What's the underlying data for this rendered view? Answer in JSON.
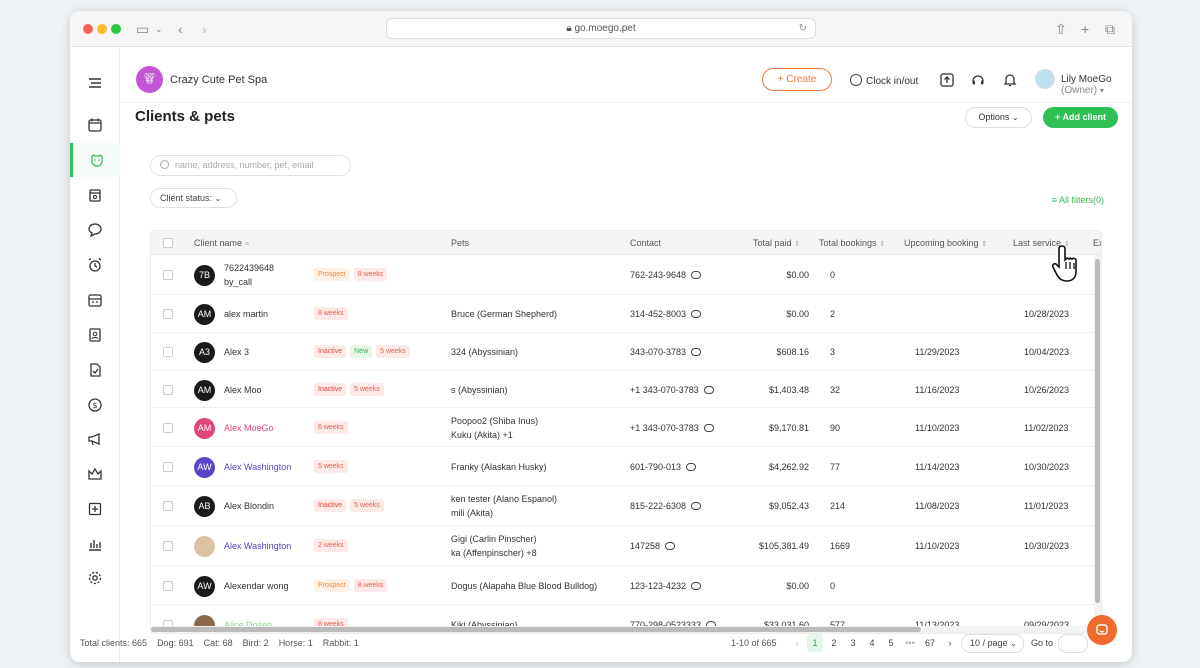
{
  "browser": {
    "url": "go.moego.pet"
  },
  "header": {
    "business_name": "Crazy Cute Pet Spa",
    "create_label": "+ Create",
    "clock_label": "Clock in/out",
    "user_name": "Lily MoeGo",
    "user_role": "(Owner)"
  },
  "sidebar": {
    "items": [
      "menu-icon",
      "calendar-icon",
      "pet-icon",
      "store-icon",
      "message-icon",
      "alarm-icon",
      "schedule-icon",
      "staff-icon",
      "card-icon",
      "dollar-icon",
      "megaphone-icon",
      "crown-icon",
      "report-icon",
      "chart-icon",
      "settings-icon"
    ],
    "active": "pet-icon"
  },
  "page": {
    "title": "Clients & pets",
    "options_label": "Options",
    "add_client_label": "+ Add client"
  },
  "filters": {
    "search_placeholder": "name, address, number, pet, email",
    "client_status_label": "Client status:",
    "all_filters_label": "All filters(0)"
  },
  "table": {
    "columns": [
      "Client name",
      "Pets",
      "Contact",
      "Total paid",
      "Total bookings",
      "Upcoming booking",
      "Last service",
      "Ex"
    ],
    "rows": [
      {
        "initials": "7B",
        "name": "7622439648",
        "subname": "by_call",
        "tags": [
          [
            "prospect",
            "Prospect"
          ],
          [
            "weeks",
            "8 weeks"
          ]
        ],
        "pets": [
          "",
          ""
        ],
        "contact": "762-243-9648",
        "paid": "$0.00",
        "bookings": "0",
        "upcoming": "",
        "last": "",
        "name_color": "#333",
        "avatar_bg": "#1a1a1a"
      },
      {
        "initials": "AM",
        "name": "alex martin",
        "subname": "",
        "tags": [
          [
            "weeks",
            "8 weeks"
          ]
        ],
        "pets": [
          "Bruce (German Shepherd)",
          ""
        ],
        "contact": "314-452-8003",
        "paid": "$0.00",
        "bookings": "2",
        "upcoming": "",
        "last": "10/28/2023",
        "name_color": "#333",
        "avatar_bg": "#1a1a1a"
      },
      {
        "initials": "A3",
        "name": "Alex 3",
        "subname": "",
        "tags": [
          [
            "inactive",
            "Inactive"
          ],
          [
            "new",
            "New"
          ],
          [
            "weeks",
            "5 weeks"
          ]
        ],
        "pets": [
          "324 (Abyssinian)",
          ""
        ],
        "contact": "343-070-3783",
        "paid": "$608.16",
        "bookings": "3",
        "upcoming": "11/29/2023",
        "last": "10/04/2023",
        "name_color": "#333",
        "avatar_bg": "#1a1a1a"
      },
      {
        "initials": "AM",
        "name": "Alex Moo",
        "subname": "",
        "tags": [
          [
            "inactive",
            "Inactive"
          ],
          [
            "weeks",
            "5 weeks"
          ]
        ],
        "pets": [
          "s (Abyssinian)",
          ""
        ],
        "contact": "+1 343-070-3783",
        "paid": "$1,403.48",
        "bookings": "32",
        "upcoming": "11/16/2023",
        "last": "10/26/2023",
        "name_color": "#333",
        "avatar_bg": "#1a1a1a"
      },
      {
        "initials": "AM",
        "name": "Alex MoeGo",
        "subname": "",
        "tags": [
          [
            "weeks",
            "6 weeks"
          ]
        ],
        "pets": [
          "Poopoo2 (Shiba Inus)",
          "Kuku (Akita) +1"
        ],
        "contact": "+1 343-070-3783",
        "paid": "$9,170.81",
        "bookings": "90",
        "upcoming": "11/10/2023",
        "last": "11/02/2023",
        "name_color": "#e0457b",
        "avatar_bg": "#e0457b"
      },
      {
        "initials": "AW",
        "name": "Alex Washington",
        "subname": "",
        "tags": [
          [
            "weeks",
            "5 weeks"
          ]
        ],
        "pets": [
          "Franky (Alaskan Husky)",
          ""
        ],
        "contact": "601-790-013",
        "paid": "$4,262.92",
        "bookings": "77",
        "upcoming": "11/14/2023",
        "last": "10/30/2023",
        "name_color": "#5b44c9",
        "avatar_bg": "#5b44c9"
      },
      {
        "initials": "AB",
        "name": "Alex Blondin",
        "subname": "",
        "tags": [
          [
            "inactive",
            "Inactive"
          ],
          [
            "weeks",
            "5 weeks"
          ]
        ],
        "pets": [
          "ken tester (Alano Espanol)",
          "mili (Akita)"
        ],
        "contact": "815-222-6308",
        "paid": "$9,052.43",
        "bookings": "214",
        "upcoming": "11/08/2023",
        "last": "11/01/2023",
        "name_color": "#333",
        "avatar_bg": "#1a1a1a"
      },
      {
        "initials": "",
        "name": "Alex Washington",
        "subname": "",
        "tags": [
          [
            "weeks",
            "2 weeks"
          ]
        ],
        "pets": [
          "Gigi (Carlin Pinscher)",
          "ka (Affenpinscher) +8"
        ],
        "contact": "147258",
        "paid": "$105,381.49",
        "bookings": "1669",
        "upcoming": "11/10/2023",
        "last": "10/30/2023",
        "name_color": "#5b44c9",
        "avatar_bg": "#d8c3a5"
      },
      {
        "initials": "AW",
        "name": "Alexendar wong",
        "subname": "",
        "tags": [
          [
            "prospect",
            "Prospect"
          ],
          [
            "weeks",
            "8 weeks"
          ]
        ],
        "pets": [
          "Dogus (Alapaha Blue Blood Bulldog)",
          ""
        ],
        "contact": "123-123-4232",
        "paid": "$0.00",
        "bookings": "0",
        "upcoming": "",
        "last": "",
        "name_color": "#333",
        "avatar_bg": "#1a1a1a"
      },
      {
        "initials": "",
        "name": "Alice Dosen",
        "subname": "",
        "tags": [
          [
            "weeks",
            "8 weeks"
          ]
        ],
        "pets": [
          "Kiki (Abyssinian)",
          ""
        ],
        "contact": "770-298-0523333",
        "paid": "$33,031.60",
        "bookings": "577",
        "upcoming": "11/13/2023",
        "last": "09/29/2023",
        "name_color": "#8fd18f",
        "avatar_bg": "#8a6a4a"
      }
    ]
  },
  "footer": {
    "total_clients": "Total clients: 665",
    "dog": "Dog: 691",
    "cat": "Cat: 68",
    "bird": "Bird: 2",
    "horse": "Horse: 1",
    "rabbit": "Rabbit: 1",
    "range": "1-10 of 665",
    "pages": [
      "1",
      "2",
      "3",
      "4",
      "5",
      "•••",
      "67"
    ],
    "per_page": "10 / page",
    "goto_label": "Go to"
  },
  "colors": {
    "accent": "#2fbf54",
    "create": "#f07a3e",
    "chat": "#f26b2c"
  }
}
